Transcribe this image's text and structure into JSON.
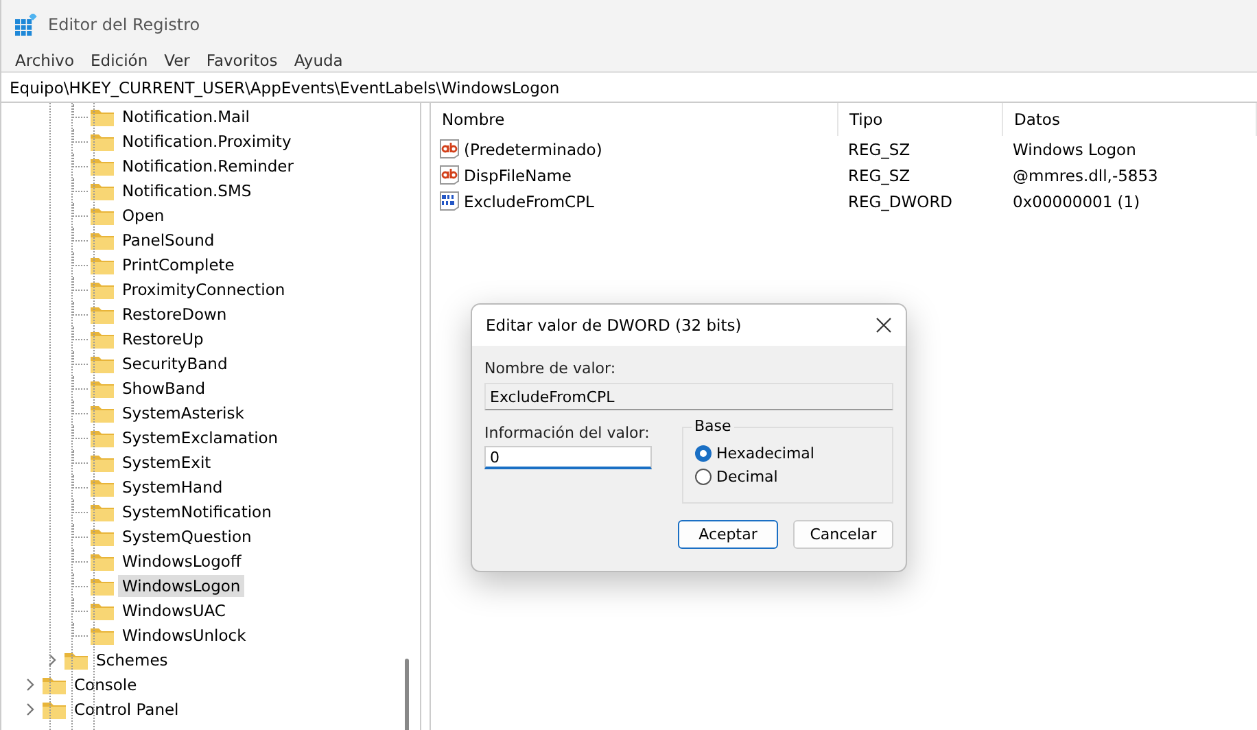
{
  "window": {
    "title": "Editor del Registro"
  },
  "menu": [
    "Archivo",
    "Edición",
    "Ver",
    "Favoritos",
    "Ayuda"
  ],
  "address": "Equipo\\HKEY_CURRENT_USER\\AppEvents\\EventLabels\\WindowsLogon",
  "tree": [
    {
      "children": [
        {
          "children": [
            {
              "label": "Notification.Mail",
              "selected": false
            },
            {
              "label": "Notification.Proximity",
              "selected": false
            },
            {
              "label": "Notification.Reminder",
              "selected": false
            },
            {
              "label": "Notification.SMS",
              "selected": false
            },
            {
              "label": "Open",
              "selected": false
            },
            {
              "label": "PanelSound",
              "selected": false
            },
            {
              "label": "PrintComplete",
              "selected": false
            },
            {
              "label": "ProximityConnection",
              "selected": false
            },
            {
              "label": "RestoreDown",
              "selected": false
            },
            {
              "label": "RestoreUp",
              "selected": false
            },
            {
              "label": "SecurityBand",
              "selected": false
            },
            {
              "label": "ShowBand",
              "selected": false
            },
            {
              "label": "SystemAsterisk",
              "selected": false
            },
            {
              "label": "SystemExclamation",
              "selected": false
            },
            {
              "label": "SystemExit",
              "selected": false
            },
            {
              "label": "SystemHand",
              "selected": false
            },
            {
              "label": "SystemNotification",
              "selected": false
            },
            {
              "label": "SystemQuestion",
              "selected": false
            },
            {
              "label": "WindowsLogoff",
              "selected": false
            },
            {
              "label": "WindowsLogon",
              "selected": true
            },
            {
              "label": "WindowsUAC",
              "selected": false
            },
            {
              "label": "WindowsUnlock",
              "selected": false
            }
          ]
        },
        {
          "label": "Schemes",
          "selected": false,
          "expanded": false
        }
      ]
    },
    {
      "label": "Console",
      "selected": false,
      "expanded": false
    },
    {
      "label": "Control Panel",
      "selected": false,
      "expanded": false
    }
  ],
  "values": {
    "columns": [
      "Nombre",
      "Tipo",
      "Datos"
    ],
    "rows": [
      {
        "kind": "string",
        "name": "(Predeterminado)",
        "type": "REG_SZ",
        "data": "Windows Logon"
      },
      {
        "kind": "string",
        "name": "DispFileName",
        "type": "REG_SZ",
        "data": "@mmres.dll,-5853"
      },
      {
        "kind": "dword",
        "name": "ExcludeFromCPL",
        "type": "REG_DWORD",
        "data": "0x00000001 (1)"
      }
    ]
  },
  "dialog": {
    "title": "Editar valor de DWORD (32 bits)",
    "name_label": "Nombre de valor:",
    "name_value": "ExcludeFromCPL",
    "data_label": "Información del valor:",
    "data_value": "0",
    "base_label": "Base",
    "bases": [
      {
        "label": "Hexadecimal",
        "selected": true
      },
      {
        "label": "Decimal",
        "selected": false
      }
    ],
    "buttons": [
      {
        "label": "Aceptar",
        "default": true
      },
      {
        "label": "Cancelar",
        "default": false
      }
    ]
  }
}
